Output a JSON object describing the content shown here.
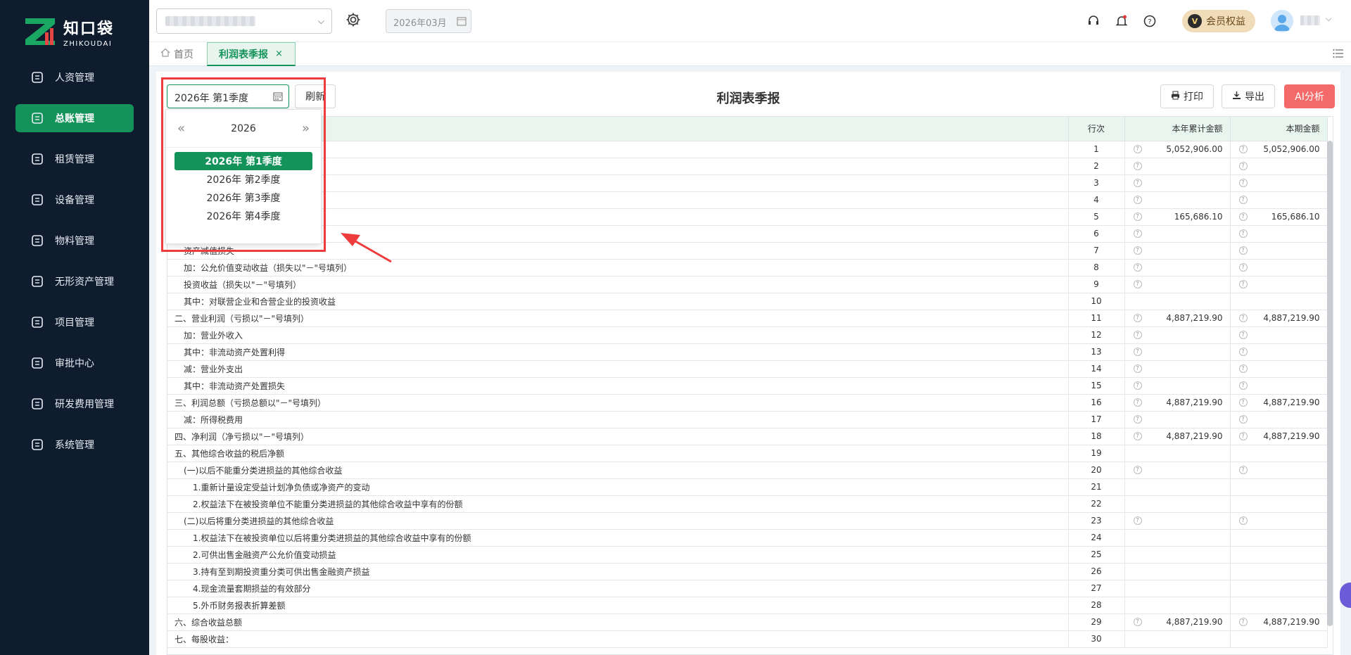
{
  "brand": {
    "name_cn": "知口袋",
    "name_en": "ZHIKOUDAI"
  },
  "sidebar": {
    "items": [
      {
        "label": "人资管理",
        "icon": "user-circle-icon",
        "active": false
      },
      {
        "label": "总账管理",
        "icon": "ledger-icon",
        "active": true
      },
      {
        "label": "租赁管理",
        "icon": "lease-icon",
        "active": false
      },
      {
        "label": "设备管理",
        "icon": "device-icon",
        "active": false
      },
      {
        "label": "物料管理",
        "icon": "material-icon",
        "active": false
      },
      {
        "label": "无形资产管理",
        "icon": "intangible-asset-icon",
        "active": false
      },
      {
        "label": "项目管理",
        "icon": "project-icon",
        "active": false
      },
      {
        "label": "审批中心",
        "icon": "approval-icon",
        "active": false
      },
      {
        "label": "研发费用管理",
        "icon": "rnd-icon",
        "active": false
      },
      {
        "label": "系统管理",
        "icon": "gear-icon",
        "active": false
      }
    ]
  },
  "header": {
    "period": "2026年03月",
    "member_label": "会员权益",
    "member_badge": "V"
  },
  "tabs": {
    "home": "首页",
    "active": "利润表季报",
    "close": "×"
  },
  "toolbar": {
    "quarter_value": "2026年 第1季度",
    "refresh_label": "刷新",
    "title": "利润表季报",
    "print_label": "打印",
    "export_label": "导出",
    "ai_label": "AI分析"
  },
  "dropdown": {
    "year": "2026",
    "prev": "«",
    "next": "»",
    "options": [
      "2026年 第1季度",
      "2026年 第2季度",
      "2026年 第3季度",
      "2026年 第4季度"
    ],
    "selected_index": 0
  },
  "table": {
    "headers": [
      "",
      "行次",
      "本年累计金额",
      "本期金额"
    ],
    "rows": [
      {
        "item": "",
        "line": "1",
        "ytd": "5,052,906.00",
        "cur": "5,052,906.00",
        "q": true
      },
      {
        "item": "",
        "line": "2",
        "ytd": "",
        "cur": "",
        "q": true
      },
      {
        "item": "",
        "line": "3",
        "ytd": "",
        "cur": "",
        "q": true
      },
      {
        "item": "",
        "line": "4",
        "ytd": "",
        "cur": "",
        "q": true
      },
      {
        "item": "",
        "line": "5",
        "ytd": "165,686.10",
        "cur": "165,686.10",
        "q": true
      },
      {
        "item": "",
        "line": "6",
        "ytd": "",
        "cur": "",
        "q": true
      },
      {
        "item": "资产减值损失",
        "line": "7",
        "ytd": "",
        "cur": "",
        "q": true,
        "indent": 1
      },
      {
        "item": "加：公允价值变动收益（损失以\"－\"号填列）",
        "line": "8",
        "ytd": "",
        "cur": "",
        "q": true,
        "indent": 1
      },
      {
        "item": "投资收益（损失以\"－\"号填列）",
        "line": "9",
        "ytd": "",
        "cur": "",
        "q": true,
        "indent": 1
      },
      {
        "item": "其中：对联营企业和合营企业的投资收益",
        "line": "10",
        "ytd": "",
        "cur": "",
        "q": false,
        "indent": 1
      },
      {
        "item": "二、营业利润（亏损以\"－\"号填列）",
        "line": "11",
        "ytd": "4,887,219.90",
        "cur": "4,887,219.90",
        "q": true,
        "indent": 0
      },
      {
        "item": "加：营业外收入",
        "line": "12",
        "ytd": "",
        "cur": "",
        "q": true,
        "indent": 1
      },
      {
        "item": "其中：非流动资产处置利得",
        "line": "13",
        "ytd": "",
        "cur": "",
        "q": true,
        "indent": 1
      },
      {
        "item": "减：营业外支出",
        "line": "14",
        "ytd": "",
        "cur": "",
        "q": true,
        "indent": 1
      },
      {
        "item": "其中：非流动资产处置损失",
        "line": "15",
        "ytd": "",
        "cur": "",
        "q": true,
        "indent": 1
      },
      {
        "item": "三、利润总额（亏损总额以\"－\"号填列）",
        "line": "16",
        "ytd": "4,887,219.90",
        "cur": "4,887,219.90",
        "q": true,
        "indent": 0
      },
      {
        "item": "减：所得税费用",
        "line": "17",
        "ytd": "",
        "cur": "",
        "q": true,
        "indent": 1
      },
      {
        "item": "四、净利润（净亏损以\"－\"号填列）",
        "line": "18",
        "ytd": "4,887,219.90",
        "cur": "4,887,219.90",
        "q": true,
        "indent": 0
      },
      {
        "item": "五、其他综合收益的税后净额",
        "line": "19",
        "ytd": "",
        "cur": "",
        "q": false,
        "indent": 0
      },
      {
        "item": "(一)以后不能重分类进损益的其他综合收益",
        "line": "20",
        "ytd": "",
        "cur": "",
        "q": true,
        "indent": 1
      },
      {
        "item": "1.重新计量设定受益计划净负债或净资产的变动",
        "line": "21",
        "ytd": "",
        "cur": "",
        "q": false,
        "indent": 2
      },
      {
        "item": "2.权益法下在被投资单位不能重分类进损益的其他综合收益中享有的份额",
        "line": "22",
        "ytd": "",
        "cur": "",
        "q": false,
        "indent": 2
      },
      {
        "item": "(二)以后将重分类进损益的其他综合收益",
        "line": "23",
        "ytd": "",
        "cur": "",
        "q": true,
        "indent": 1
      },
      {
        "item": "1.权益法下在被投资单位以后将重分类进损益的其他综合收益中享有的份额",
        "line": "24",
        "ytd": "",
        "cur": "",
        "q": false,
        "indent": 2
      },
      {
        "item": "2.可供出售金融资产公允价值变动损益",
        "line": "25",
        "ytd": "",
        "cur": "",
        "q": false,
        "indent": 2
      },
      {
        "item": "3.持有至到期投资重分类可供出售金融资产损益",
        "line": "26",
        "ytd": "",
        "cur": "",
        "q": false,
        "indent": 2
      },
      {
        "item": "4.现金流量套期损益的有效部分",
        "line": "27",
        "ytd": "",
        "cur": "",
        "q": false,
        "indent": 2
      },
      {
        "item": "5.外币财务报表折算差额",
        "line": "28",
        "ytd": "",
        "cur": "",
        "q": false,
        "indent": 2
      },
      {
        "item": "六、综合收益总额",
        "line": "29",
        "ytd": "4,887,219.90",
        "cur": "4,887,219.90",
        "q": true,
        "indent": 0
      },
      {
        "item": "七、每股收益：",
        "line": "30",
        "ytd": "",
        "cur": "",
        "q": false,
        "indent": 0
      }
    ]
  },
  "colors": {
    "primary": "#13935a",
    "sidebar_bg": "#0f1c2e",
    "ai": "#f46a6a",
    "annotation": "#ee3b3b"
  }
}
